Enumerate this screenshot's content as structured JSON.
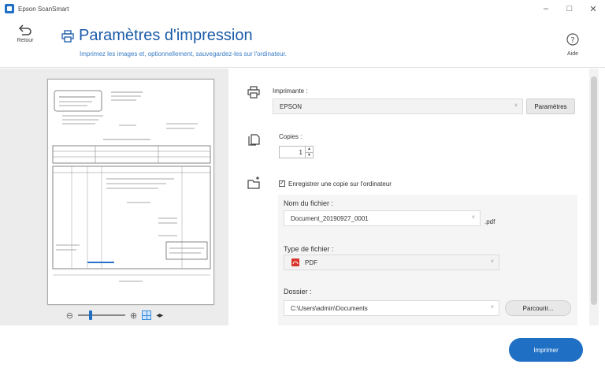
{
  "window": {
    "title": "Epson ScanSmart",
    "minimize": "–",
    "maximize": "□",
    "close": "✕"
  },
  "header": {
    "back_label": "Retour",
    "title": "Paramètres d'impression",
    "subtitle": "Imprimez les images et, optionnellement, sauvegardez-les sur l'ordinateur.",
    "help_label": "Aide"
  },
  "printer": {
    "label": "Imprimante :",
    "value": "EPSON",
    "settings_button": "Paramètres"
  },
  "copies": {
    "label": "Copies :",
    "value": "1"
  },
  "save": {
    "checkbox_label": "Enregistrer une copie sur l'ordinateur",
    "checked": true,
    "filename_label": "Nom du fichier :",
    "filename_value": "Document_20190927_0001",
    "extension": ".pdf",
    "filetype_label": "Type de fichier :",
    "filetype_value": "PDF",
    "folder_label": "Dossier :",
    "folder_value": "C:\\Users\\admin\\Documents",
    "browse_button": "Parcourir..."
  },
  "print_button": "Imprimer",
  "colors": {
    "accent": "#1f6fc5",
    "title": "#1a5aa8",
    "preview_bg": "#ececec"
  },
  "zoom": {
    "level_fraction": 0.25
  }
}
